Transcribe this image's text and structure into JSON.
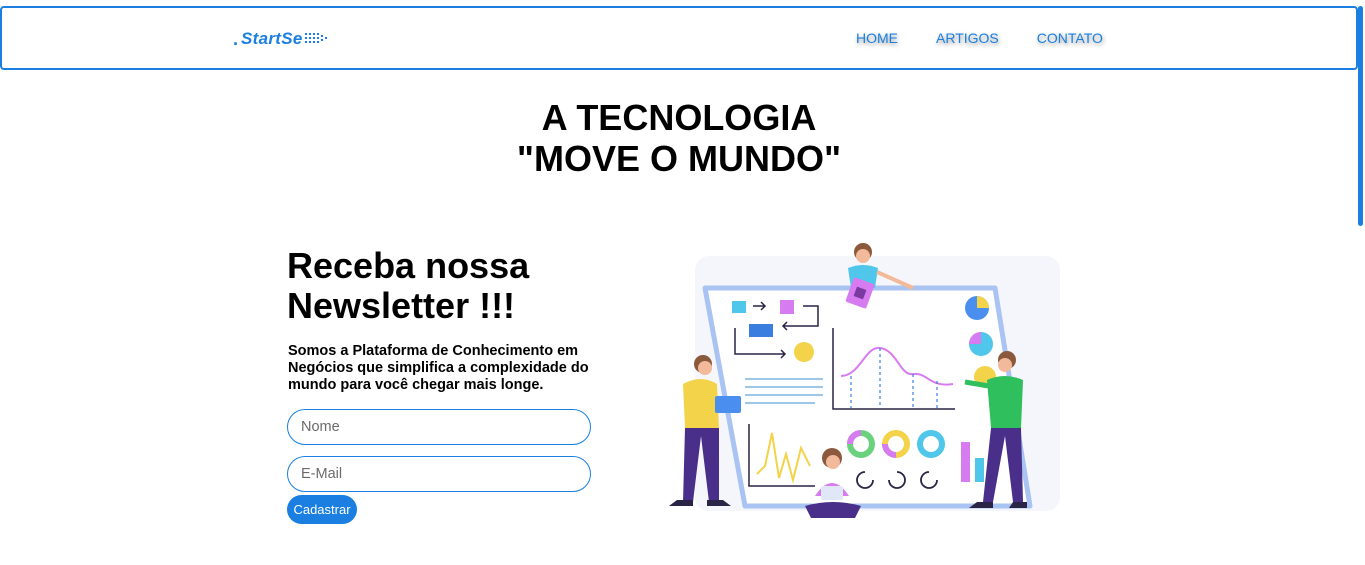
{
  "header": {
    "logo": {
      "prefix": ".",
      "text": "StartSe",
      "arrow_icon": "chevron-arrow-icon"
    },
    "nav": [
      {
        "label": "HOME"
      },
      {
        "label": "ARTIGOS"
      },
      {
        "label": "CONTATO"
      }
    ]
  },
  "hero": {
    "title_line1": "A TECNOLOGIA",
    "title_line2": "\"MOVE O MUNDO\""
  },
  "newsletter": {
    "title_line1": "Receba nossa",
    "title_line2": "Newsletter !!!",
    "description": "Somos a Plataforma de Conhecimento em Negócios que simplifica a complexidade do mundo para você chegar mais longe.",
    "name_placeholder": "Nome",
    "email_placeholder": "E-Mail",
    "submit_label": "Cadastrar"
  },
  "illustration": {
    "icon": "team-data-analytics-illustration"
  },
  "colors": {
    "accent": "#1a7fe0",
    "text": "#000000",
    "background": "#ffffff"
  }
}
